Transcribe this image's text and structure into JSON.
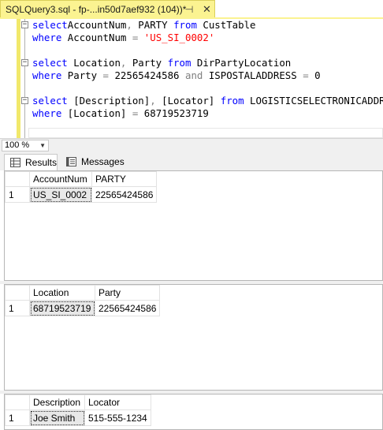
{
  "doc_tab": {
    "title": "SQLQuery3.sql - fp-...in50d7aef932 (104))*",
    "pin": "⊣",
    "close": "✕"
  },
  "editor": {
    "lines": [
      {
        "parts": [
          [
            "kw",
            "select"
          ],
          [
            "",
            "AccountNum"
          ],
          [
            "op",
            ","
          ],
          [
            "",
            " PARTY "
          ],
          [
            "kw",
            "from"
          ],
          [
            "",
            " CustTable"
          ]
        ]
      },
      {
        "parts": [
          [
            "kw",
            "where"
          ],
          [
            "",
            " AccountNum "
          ],
          [
            "op",
            "="
          ],
          [
            "",
            " "
          ],
          [
            "str",
            "'US_SI_0002'"
          ]
        ]
      },
      {
        "parts": []
      },
      {
        "parts": [
          [
            "kw",
            "select"
          ],
          [
            "",
            " Location"
          ],
          [
            "op",
            ","
          ],
          [
            "",
            " Party "
          ],
          [
            "kw",
            "from"
          ],
          [
            "",
            " DirPartyLocation"
          ]
        ]
      },
      {
        "parts": [
          [
            "kw",
            "where"
          ],
          [
            "",
            " Party "
          ],
          [
            "op",
            "="
          ],
          [
            "",
            " 22565424586 "
          ],
          [
            "op",
            "and"
          ],
          [
            "",
            " ISPOSTALADDRESS "
          ],
          [
            "op",
            "="
          ],
          [
            "",
            " 0"
          ]
        ]
      },
      {
        "parts": []
      },
      {
        "parts": [
          [
            "kw",
            "select"
          ],
          [
            "",
            " [Description]"
          ],
          [
            "op",
            ","
          ],
          [
            "",
            " [Locator] "
          ],
          [
            "kw",
            "from"
          ],
          [
            "",
            " LOGISTICSELECTRONICADDRESS"
          ]
        ]
      },
      {
        "parts": [
          [
            "kw",
            "where"
          ],
          [
            "",
            " [Location] "
          ],
          [
            "op",
            "="
          ],
          [
            "",
            " 68719523719"
          ]
        ]
      }
    ]
  },
  "zoom": {
    "value": "100 %",
    "arrow": "▼"
  },
  "results_tabs": {
    "results": "Results",
    "messages": "Messages"
  },
  "result_sets": [
    {
      "columns": [
        "AccountNum",
        "PARTY"
      ],
      "rows": [
        {
          "num": "1",
          "cells": [
            "US_SI_0002",
            "22565424586"
          ]
        }
      ]
    },
    {
      "columns": [
        "Location",
        "Party"
      ],
      "rows": [
        {
          "num": "1",
          "cells": [
            "68719523719",
            "22565424586"
          ]
        }
      ]
    },
    {
      "columns": [
        "Description",
        "Locator"
      ],
      "rows": [
        {
          "num": "1",
          "cells": [
            "Joe Smith",
            "515-555-1234"
          ]
        }
      ]
    }
  ]
}
